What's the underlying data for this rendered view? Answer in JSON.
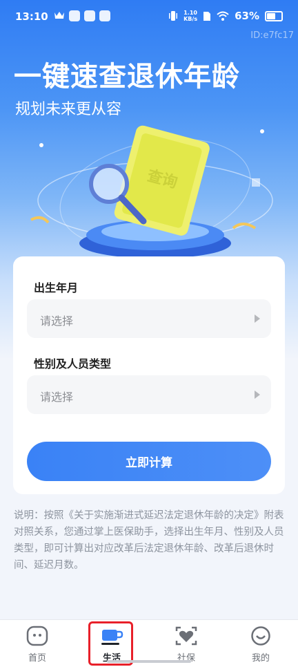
{
  "status_bar": {
    "time": "13:10",
    "net_speed_value": "1.10",
    "net_speed_unit": "KB/s",
    "battery": "63%"
  },
  "watermark": "ID:e7fc17",
  "hero": {
    "title": "一键速查退休年龄",
    "subtitle": "规划未来更从容",
    "card_stamp": "查询"
  },
  "form": {
    "birth_label": "出生年月",
    "birth_placeholder": "请选择",
    "type_label": "性别及人员类型",
    "type_placeholder": "请选择",
    "submit_label": "立即计算"
  },
  "description": "说明：按照《关于实施渐进式延迟法定退休年龄的决定》附表对照关系，您通过掌上医保助手，选择出生年月、性别及人员类型，即可计算出对应改革后法定退休年龄、改革后退休时间、延迟月数。",
  "tabbar": {
    "items": [
      {
        "label": "首页",
        "icon": "home-face-icon"
      },
      {
        "label": "生活",
        "icon": "coffee-cup-icon"
      },
      {
        "label": "社保",
        "icon": "heart-frame-icon"
      },
      {
        "label": "我的",
        "icon": "smiley-icon"
      }
    ],
    "active_index": 1,
    "highlight_color": "#e8202a"
  },
  "colors": {
    "brand_blue": "#3a82f6",
    "text_gray": "#8d949f"
  }
}
